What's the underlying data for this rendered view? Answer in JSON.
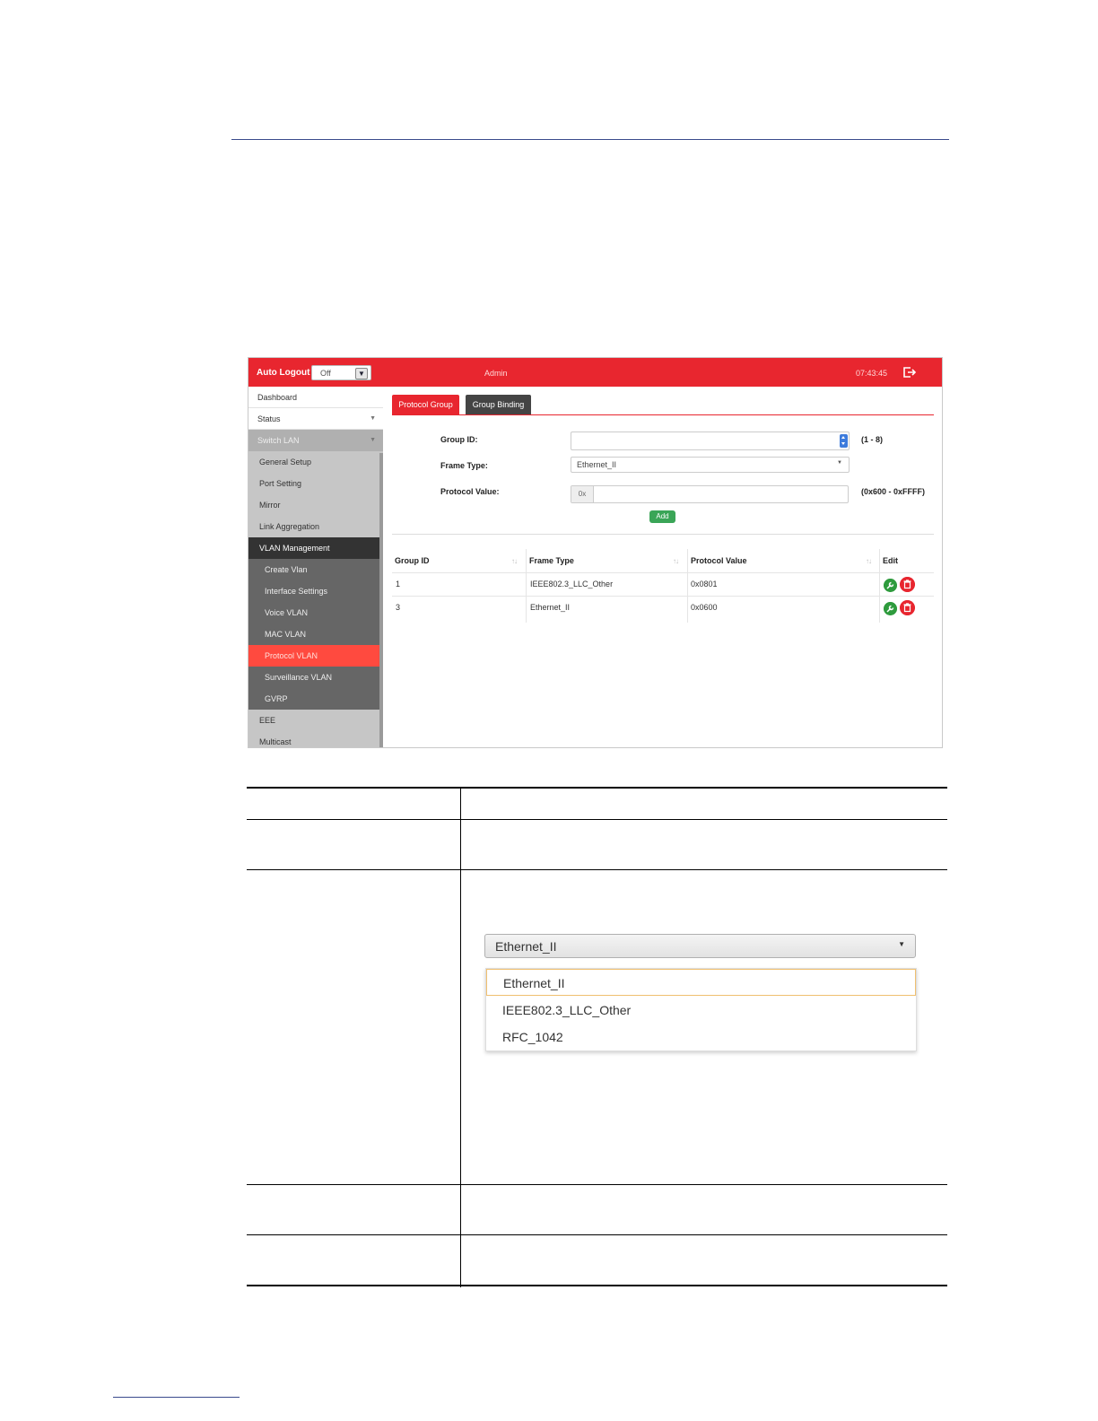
{
  "header": {
    "auto_logout_label": "Auto Logout :",
    "auto_logout_value": "Off",
    "user": "Admin",
    "time": "07:43:45"
  },
  "sidebar": {
    "items": [
      {
        "label": "Dashboard"
      },
      {
        "label": "Status"
      },
      {
        "label": "Switch LAN"
      },
      {
        "label": "General Setup"
      },
      {
        "label": "Port Setting"
      },
      {
        "label": "Mirror"
      },
      {
        "label": "Link Aggregation"
      },
      {
        "label": "VLAN Management"
      },
      {
        "label": "Create Vlan"
      },
      {
        "label": "Interface Settings"
      },
      {
        "label": "Voice VLAN"
      },
      {
        "label": "MAC VLAN"
      },
      {
        "label": "Protocol VLAN"
      },
      {
        "label": "Surveillance VLAN"
      },
      {
        "label": "GVRP"
      },
      {
        "label": "EEE"
      },
      {
        "label": "Multicast"
      }
    ]
  },
  "tabs": [
    {
      "label": "Protocol Group"
    },
    {
      "label": "Group Binding"
    }
  ],
  "form": {
    "group_id_label": "Group ID:",
    "group_id_hint": "(1 - 8)",
    "frame_type_label": "Frame Type:",
    "frame_type_value": "Ethernet_II",
    "protocol_value_label": "Protocol Value:",
    "protocol_prefix": "0x",
    "protocol_hint": "(0x600 - 0xFFFF)",
    "add_label": "Add"
  },
  "table": {
    "columns": [
      "Group ID",
      "Frame Type",
      "Protocol Value",
      "Edit"
    ],
    "rows": [
      {
        "group_id": "1",
        "frame_type": "IEEE802.3_LLC_Other",
        "protocol_value": "0x0801"
      },
      {
        "group_id": "3",
        "frame_type": "Ethernet_II",
        "protocol_value": "0x0600"
      }
    ]
  },
  "dropdown": {
    "selected": "Ethernet_II",
    "options": [
      "Ethernet_II",
      "IEEE802.3_LLC_Other",
      "RFC_1042"
    ]
  },
  "colors": {
    "accent_red": "#e8262f",
    "active_nav": "#ff4a3f",
    "add_green": "#3aa557",
    "rule_blue": "#3a4a8c"
  }
}
